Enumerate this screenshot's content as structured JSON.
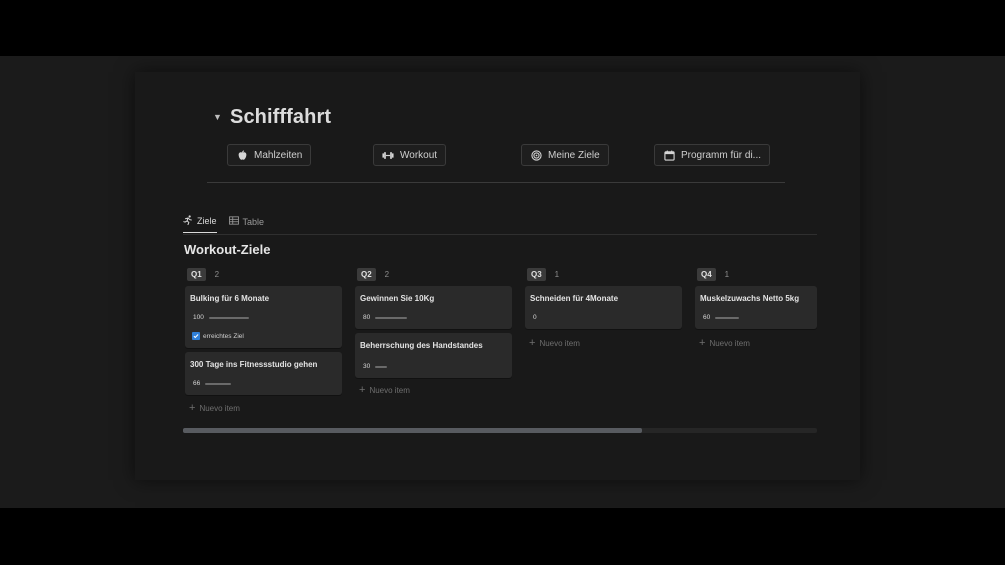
{
  "page": {
    "title": "Schifffahrt",
    "toggle_icon": "triangle-down"
  },
  "buttons": [
    {
      "label": "Mahlzeiten",
      "icon": "apple-icon"
    },
    {
      "label": "Workout",
      "icon": "dumbbell-icon"
    },
    {
      "label": "Meine Ziele",
      "icon": "target-icon"
    },
    {
      "label": "Programm für di...",
      "icon": "calendar-icon"
    }
  ],
  "tabs": [
    {
      "label": "Ziele",
      "icon": "running-icon",
      "active": true
    },
    {
      "label": "Table",
      "icon": "table-icon",
      "active": false
    }
  ],
  "database": {
    "title": "Workout-Ziele",
    "new_item_label": "Nuevo item",
    "columns": [
      {
        "tag": "Q1",
        "count": "2",
        "cards": [
          {
            "title": "Bulking für 6 Monate",
            "value": "100",
            "progress": 1.0,
            "checkbox": {
              "checked": true,
              "label": "erreichtes Ziel"
            }
          },
          {
            "title": "300 Tage ins Fitnessstudio gehen",
            "value": "66",
            "progress": 0.66
          }
        ]
      },
      {
        "tag": "Q2",
        "count": "2",
        "cards": [
          {
            "title": "Gewinnen Sie 10Kg",
            "value": "80",
            "progress": 0.8
          },
          {
            "title": "Beherrschung des Handstandes",
            "value": "30",
            "progress": 0.3
          }
        ]
      },
      {
        "tag": "Q3",
        "count": "1",
        "cards": [
          {
            "title": "Schneiden für 4Monate",
            "value": "0",
            "progress": 0
          }
        ]
      },
      {
        "tag": "Q4",
        "count": "1",
        "cards": [
          {
            "title": "Muskelzuwachs Netto 5kg",
            "value": "60",
            "progress": 0.6
          }
        ]
      }
    ]
  },
  "colors": {
    "background": "#191919",
    "card": "#2a2a2a",
    "checkbox": "#2f7fd8",
    "scroll_thumb": "#585b60"
  }
}
